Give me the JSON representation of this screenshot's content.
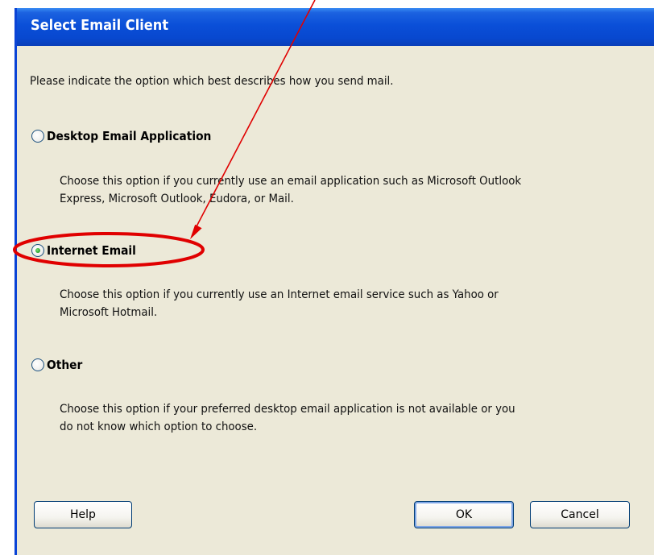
{
  "dialog": {
    "title": "Select Email Client",
    "intro": "Please indicate the option which best describes how you send mail.",
    "options": [
      {
        "label": "Desktop Email Application",
        "selected": false,
        "description": [
          "Choose this option if you currently use an email application such as Microsoft Outlook",
          "Express, Microsoft Outlook, Eudora, or Mail."
        ]
      },
      {
        "label": "Internet Email",
        "selected": true,
        "description": [
          "Choose this option if you currently use an Internet email service such as Yahoo or",
          "Microsoft Hotmail."
        ]
      },
      {
        "label": "Other",
        "selected": false,
        "description": [
          "Choose this option if your preferred desktop email application is not available or you",
          "do not know which option to choose."
        ]
      }
    ],
    "buttons": {
      "help": "Help",
      "ok": "OK",
      "cancel": "Cancel"
    }
  },
  "colors": {
    "titlebar": "#0a4fd8",
    "dialog_bg": "#ece9d8",
    "annotation": "#e00000",
    "radio_dot": "#2fa82f"
  }
}
